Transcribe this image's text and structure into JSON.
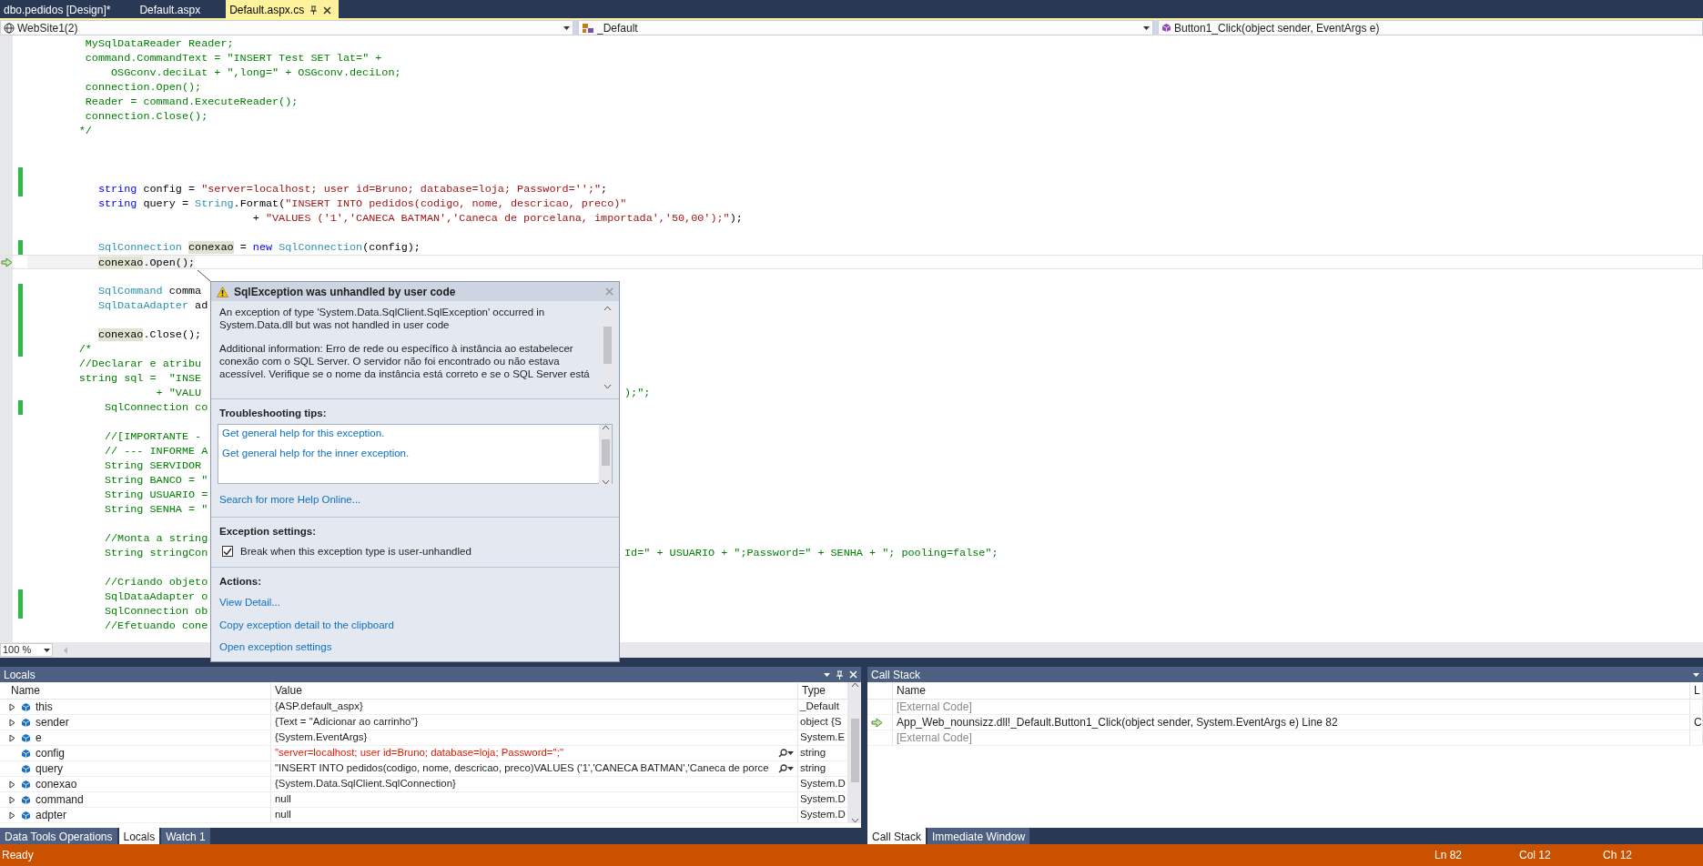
{
  "document_tabs": [
    {
      "label": "dbo.pedidos [Design]*",
      "selected": false
    },
    {
      "label": "Default.aspx",
      "selected": false
    },
    {
      "label": "Default.aspx.cs",
      "selected": true
    }
  ],
  "navigation_bar": [
    {
      "kind": "project",
      "text": "WebSite1(2)"
    },
    {
      "kind": "type",
      "text": "_Default"
    },
    {
      "kind": "member",
      "text": "Button1_Click(object sender, EventArgs e)"
    }
  ],
  "editor": {
    "zoom": "100 %",
    "lines": [
      {
        "changed": false,
        "current": false,
        "tokens": [
          {
            "kind": "comment",
            "text": "         MySqlDataReader Reader;"
          }
        ]
      },
      {
        "changed": false,
        "current": false,
        "tokens": [
          {
            "kind": "comment",
            "text": "         command.CommandText = \"INSERT Test SET lat=\" +"
          }
        ]
      },
      {
        "changed": false,
        "current": false,
        "tokens": [
          {
            "kind": "comment",
            "text": "             OSGconv.deciLat + \",long=\" + OSGconv.deciLon;"
          }
        ]
      },
      {
        "changed": false,
        "current": false,
        "tokens": [
          {
            "kind": "comment",
            "text": "         connection.Open();"
          }
        ]
      },
      {
        "changed": false,
        "current": false,
        "tokens": [
          {
            "kind": "comment",
            "text": "         Reader = command.ExecuteReader();"
          }
        ]
      },
      {
        "changed": false,
        "current": false,
        "tokens": [
          {
            "kind": "comment",
            "text": "         connection.Close();"
          }
        ]
      },
      {
        "changed": false,
        "current": false,
        "tokens": [
          {
            "kind": "comment",
            "text": "        */"
          }
        ]
      },
      {
        "changed": false,
        "current": false
      },
      {
        "changed": false,
        "current": false
      },
      {
        "changed": true,
        "current": false
      },
      {
        "changed": true,
        "current": false,
        "tokens": [
          {
            "kind": "keyword",
            "text": "           string"
          },
          {
            "kind": "plain",
            "text": " config = "
          },
          {
            "kind": "string",
            "text": "\"server=localhost; user id=Bruno; database=loja; Password='';\""
          },
          {
            "kind": "plain",
            "text": ";"
          }
        ]
      },
      {
        "changed": false,
        "current": false,
        "tokens": [
          {
            "kind": "keyword",
            "text": "           string"
          },
          {
            "kind": "plain",
            "text": " query = "
          },
          {
            "kind": "type",
            "text": "String"
          },
          {
            "kind": "plain",
            "text": ".Format("
          },
          {
            "kind": "string",
            "text": "\"INSERT INTO pedidos(codigo, nome, descricao, preco)\""
          }
        ]
      },
      {
        "changed": false,
        "current": false,
        "tokens": [
          {
            "kind": "plain",
            "text": "                                   + "
          },
          {
            "kind": "string",
            "text": "\"VALUES ('1','CANECA BATMAN','Caneca de porcelana, importada','50,00');\""
          },
          {
            "kind": "plain",
            "text": ");"
          }
        ]
      },
      {
        "changed": false,
        "current": false
      },
      {
        "changed": true,
        "current": false,
        "tokens": [
          {
            "kind": "type",
            "text": "           SqlConnection"
          },
          {
            "kind": "reference",
            "text": " conexao"
          },
          {
            "kind": "plain",
            "text": " = "
          },
          {
            "kind": "keyword",
            "text": "new"
          },
          {
            "kind": "type",
            "text": " SqlConnection"
          },
          {
            "kind": "plain",
            "text": "(config);"
          }
        ]
      },
      {
        "changed": false,
        "current": true,
        "tokens": [
          {
            "kind": "reference",
            "text": "           conexao"
          },
          {
            "kind": "plain",
            "text": ".Open();"
          }
        ]
      },
      {
        "changed": false,
        "current": false
      },
      {
        "changed": true,
        "current": false,
        "tokens": [
          {
            "kind": "type",
            "text": "           SqlCommand"
          },
          {
            "kind": "plain",
            "text": " comma"
          }
        ]
      },
      {
        "changed": true,
        "current": false,
        "tokens": [
          {
            "kind": "type",
            "text": "           SqlDataAdapter"
          },
          {
            "kind": "plain",
            "text": " ad"
          }
        ]
      },
      {
        "changed": true,
        "current": false
      },
      {
        "changed": true,
        "current": false,
        "tokens": [
          {
            "kind": "reference",
            "text": "           conexao"
          },
          {
            "kind": "plain",
            "text": ".Close();"
          }
        ]
      },
      {
        "changed": true,
        "current": false,
        "tokens": [
          {
            "kind": "comment",
            "text": "        /*"
          }
        ]
      },
      {
        "changed": false,
        "current": false,
        "tokens": [
          {
            "kind": "comment",
            "text": "        //Declarar e atribu"
          }
        ]
      },
      {
        "changed": false,
        "current": false,
        "tokens": [
          {
            "kind": "comment",
            "text": "        string sql =  \"INSE"
          }
        ]
      },
      {
        "changed": false,
        "current": false,
        "tokens": [
          {
            "kind": "comment",
            "text": "                    + \"VALU"
          }
        ],
        "tail": [
          {
            "kind": "comment",
            "text": ");\";"
          }
        ]
      },
      {
        "changed": true,
        "current": false,
        "tokens": [
          {
            "kind": "comment",
            "text": "            SqlConnection co"
          }
        ]
      },
      {
        "changed": false,
        "current": false
      },
      {
        "changed": false,
        "current": false,
        "tokens": [
          {
            "kind": "comment",
            "text": "            //[IMPORTANTE -"
          }
        ]
      },
      {
        "changed": false,
        "current": false,
        "tokens": [
          {
            "kind": "comment",
            "text": "            // --- INFORME A"
          }
        ]
      },
      {
        "changed": false,
        "current": false,
        "tokens": [
          {
            "kind": "comment",
            "text": "            String SERVIDOR"
          }
        ]
      },
      {
        "changed": false,
        "current": false,
        "tokens": [
          {
            "kind": "comment",
            "text": "            String BANCO = \""
          }
        ]
      },
      {
        "changed": false,
        "current": false,
        "tokens": [
          {
            "kind": "comment",
            "text": "            String USUARIO ="
          }
        ]
      },
      {
        "changed": false,
        "current": false,
        "tokens": [
          {
            "kind": "comment",
            "text": "            String SENHA = \""
          }
        ]
      },
      {
        "changed": false,
        "current": false
      },
      {
        "changed": false,
        "current": false,
        "tokens": [
          {
            "kind": "comment",
            "text": "            //Monta a string"
          }
        ]
      },
      {
        "changed": false,
        "current": false,
        "tokens": [
          {
            "kind": "comment",
            "text": "            String stringCon"
          }
        ],
        "tail": [
          {
            "kind": "comment",
            "text": "Id=\" + USUARIO + \";Password=\" + SENHA + \"; pooling=false\";"
          }
        ]
      },
      {
        "changed": false,
        "current": false
      },
      {
        "changed": false,
        "current": false,
        "tokens": [
          {
            "kind": "comment",
            "text": "            //Criando objeto"
          }
        ]
      },
      {
        "changed": true,
        "current": false,
        "tokens": [
          {
            "kind": "comment",
            "text": "            SqlDataAdapter o"
          }
        ]
      },
      {
        "changed": true,
        "current": false,
        "tokens": [
          {
            "kind": "comment",
            "text": "            SqlConnection ob"
          }
        ]
      },
      {
        "changed": false,
        "current": false,
        "tokens": [
          {
            "kind": "comment",
            "text": "            //Efetuando cone"
          }
        ]
      }
    ]
  },
  "exception_popup": {
    "title": "SqlException was unhandled by user code",
    "message": [
      "An exception of type 'System.Data.SqlClient.SqlException' occurred in System.Data.dll but was not handled in user code",
      "Additional information: Erro de rede ou específico à instância ao estabelecer conexão com o SQL Server. O servidor não foi encontrado ou não estava acessível. Verifique se o nome da instância está correto e se o SQL Server está"
    ],
    "tips_heading": "Troubleshooting tips:",
    "tips": [
      "Get general help for this exception.",
      "Get general help for the inner exception."
    ],
    "search_link": "Search for more Help Online...",
    "settings_heading": "Exception settings:",
    "break_option": {
      "label": "Break when this exception type is user-unhandled",
      "checked": true
    },
    "actions_heading": "Actions:",
    "actions": [
      "View Detail...",
      "Copy exception detail to the clipboard",
      "Open exception settings"
    ]
  },
  "locals": {
    "title": "Locals",
    "columns": [
      "Name",
      "Value",
      "Type"
    ],
    "rows": [
      {
        "name": "this",
        "value": "{ASP.default_aspx}",
        "type": "_Default",
        "expandable": true,
        "changed": false,
        "visualizer": false
      },
      {
        "name": "sender",
        "value": "{Text = \"Adicionar ao carrinho\"}",
        "type": "object {S",
        "expandable": true,
        "changed": false,
        "visualizer": false
      },
      {
        "name": "e",
        "value": "{System.EventArgs}",
        "type": "System.E",
        "expandable": true,
        "changed": false,
        "visualizer": false
      },
      {
        "name": "config",
        "value": "\"server=localhost; user id=Bruno; database=loja; Password='';\"",
        "type": "string",
        "expandable": false,
        "changed": true,
        "visualizer": true
      },
      {
        "name": "query",
        "value": "\"INSERT INTO pedidos(codigo, nome, descricao, preco)VALUES ('1','CANECA BATMAN','Caneca de porce",
        "type": "string",
        "expandable": false,
        "changed": false,
        "visualizer": true
      },
      {
        "name": "conexao",
        "value": "{System.Data.SqlClient.SqlConnection}",
        "type": "System.D",
        "expandable": true,
        "changed": false,
        "visualizer": false
      },
      {
        "name": "command",
        "value": "null",
        "type": "System.D",
        "expandable": true,
        "changed": false,
        "visualizer": false
      },
      {
        "name": "adpter",
        "value": "null",
        "type": "System.D",
        "expandable": true,
        "changed": false,
        "visualizer": false
      }
    ],
    "tabs": [
      {
        "label": "Data Tools Operations",
        "selected": false
      },
      {
        "label": "Locals",
        "selected": true
      },
      {
        "label": "Watch 1",
        "selected": false
      }
    ]
  },
  "call_stack": {
    "title": "Call Stack",
    "columns": [
      "Name",
      "L"
    ],
    "rows": [
      {
        "name": "[External Code]",
        "kind": "external",
        "current": false
      },
      {
        "name": "App_Web_nounsizz.dll!_Default.Button1_Click(object sender, System.EventArgs e) Line 82",
        "column_2": "C",
        "kind": "frame",
        "current": true
      },
      {
        "name": "[External Code]",
        "kind": "external",
        "current": false
      }
    ],
    "tabs": [
      {
        "label": "Call Stack",
        "selected": true
      },
      {
        "label": "Immediate Window",
        "selected": false
      }
    ]
  },
  "status_bar": {
    "message": "Ready",
    "line": "Ln 82",
    "column": "Col 12",
    "char": "Ch 12"
  }
}
